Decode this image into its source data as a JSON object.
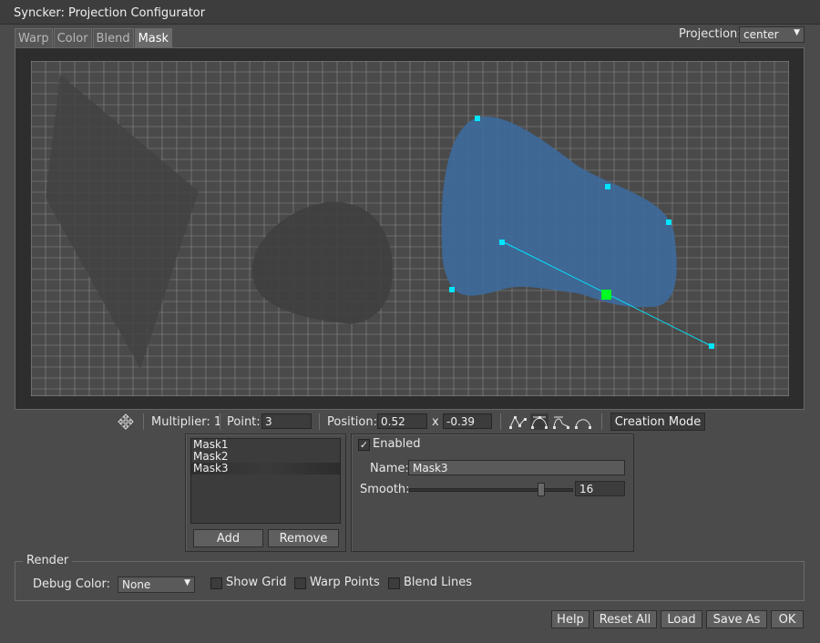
{
  "window": {
    "title": "Syncker: Projection Configurator"
  },
  "tabs": [
    {
      "label": "Warp",
      "active": false
    },
    {
      "label": "Color",
      "active": false
    },
    {
      "label": "Blend",
      "active": false
    },
    {
      "label": "Mask",
      "active": true
    }
  ],
  "projection": {
    "label": "Projection:",
    "value": "center"
  },
  "toolbar": {
    "multiplier_label": "Multiplier: 1",
    "point_label": "Point:",
    "point_value": "3",
    "position_label": "Position:",
    "position_x": "0.52",
    "position_sep": "x",
    "position_y": "-0.39",
    "tool_icons": [
      "move-icon",
      "polyline-tool-icon",
      "bezier-tool-icon",
      "smooth-tool-icon",
      "arc-tool-icon"
    ],
    "mode_button": "Creation Mode"
  },
  "masks": {
    "items": [
      "Mask1",
      "Mask2",
      "Mask3"
    ],
    "selected": 2,
    "add_label": "Add",
    "remove_label": "Remove"
  },
  "mask_props": {
    "enabled_label": "Enabled",
    "enabled": true,
    "name_label": "Name:",
    "name_value": "Mask3",
    "smooth_label": "Smooth:",
    "smooth_value": "16",
    "smooth_fraction": 0.8
  },
  "render": {
    "title": "Render",
    "debug_color_label": "Debug Color:",
    "debug_color_value": "None",
    "show_grid_label": "Show Grid",
    "warp_points_label": "Warp Points",
    "blend_lines_label": "Blend Lines"
  },
  "footer": {
    "help": "Help",
    "reset_all": "Reset All",
    "load": "Load",
    "save_as": "Save As",
    "ok": "OK"
  },
  "colors": {
    "mask_fill": "#3d6a9c",
    "control_point": "#00e5ff",
    "selected_point": "#00ff22",
    "grid_line": "#8a8a8a",
    "viewport_bg": "#4a4a4a"
  }
}
